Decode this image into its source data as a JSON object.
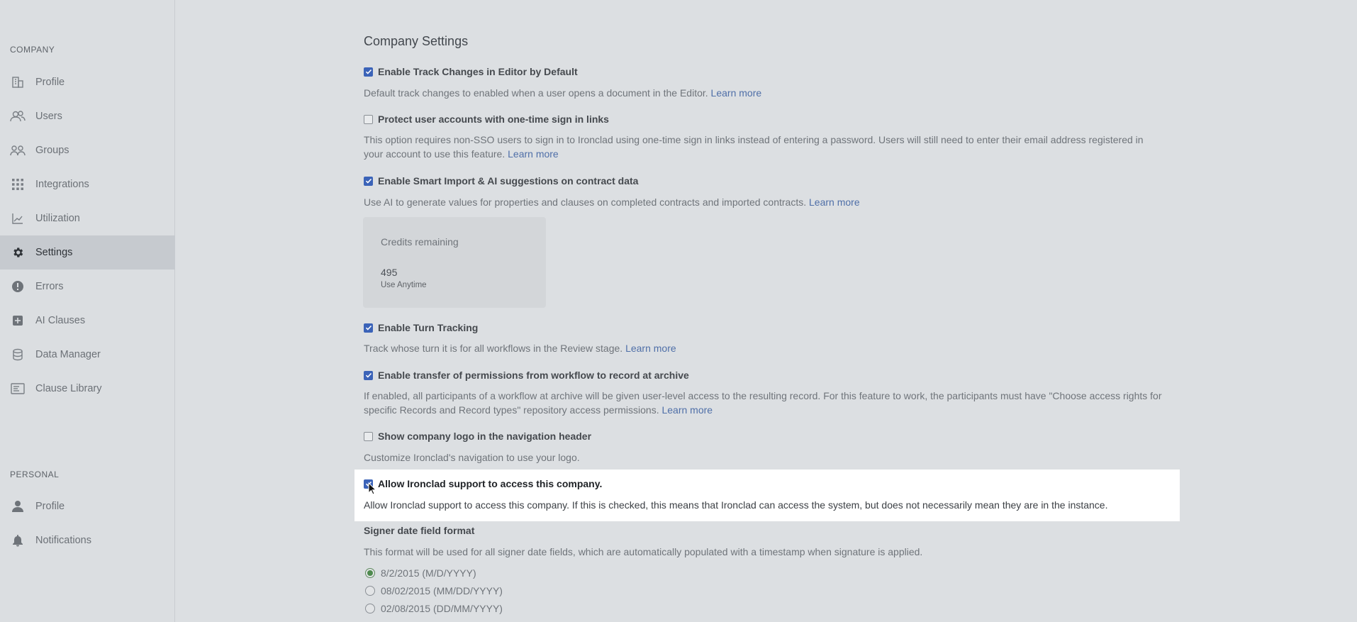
{
  "sidebar": {
    "company_label": "COMPANY",
    "company_items": [
      {
        "label": "Profile",
        "icon": "building-icon"
      },
      {
        "label": "Users",
        "icon": "users-icon"
      },
      {
        "label": "Groups",
        "icon": "groups-icon"
      },
      {
        "label": "Integrations",
        "icon": "grid-icon"
      },
      {
        "label": "Utilization",
        "icon": "chart-icon"
      },
      {
        "label": "Settings",
        "icon": "gear-icon"
      },
      {
        "label": "Errors",
        "icon": "alert-icon"
      },
      {
        "label": "AI Clauses",
        "icon": "ai-plus-icon"
      },
      {
        "label": "Data Manager",
        "icon": "database-icon"
      },
      {
        "label": "Clause Library",
        "icon": "library-icon"
      }
    ],
    "active": "Settings",
    "personal_label": "PERSONAL",
    "personal_items": [
      {
        "label": "Profile",
        "icon": "person-icon"
      },
      {
        "label": "Notifications",
        "icon": "bell-icon"
      }
    ]
  },
  "main": {
    "title": "Company Settings",
    "options": [
      {
        "label": "Enable Track Changes in Editor by Default",
        "checked": true,
        "desc": "Default track changes to enabled when a user opens a document in the Editor.",
        "link": "Learn more"
      },
      {
        "label": "Protect user accounts with one-time sign in links",
        "checked": false,
        "desc": "This option requires non-SSO users to sign in to Ironclad using one-time sign in links instead of entering a password. Users will still need to enter their email address registered in your account to use this feature.",
        "link": "Learn more"
      },
      {
        "label": "Enable Smart Import & AI suggestions on contract data",
        "checked": true,
        "desc": "Use AI to generate values for properties and clauses on completed contracts and imported contracts.",
        "link": "Learn more"
      },
      {
        "label": "Enable Turn Tracking",
        "checked": true,
        "desc": "Track whose turn it is for all workflows in the Review stage.",
        "link": "Learn more"
      },
      {
        "label": "Enable transfer of permissions from workflow to record at archive",
        "checked": true,
        "desc": "If enabled, all participants of a workflow at archive will be given user-level access to the resulting record. For this feature to work, the participants must have \"Choose access rights for specific Records and Record types\" repository access permissions.",
        "link": "Learn more"
      },
      {
        "label": "Show company logo in the navigation header",
        "checked": false,
        "desc": "Customize Ironclad's navigation to use your logo."
      },
      {
        "label": "Allow Ironclad support to access this company.",
        "checked": true,
        "desc": "Allow Ironclad support to access this company. If this is checked, this means that Ironclad can access the system, but does not necessarily mean they are in the instance."
      }
    ],
    "credits": {
      "title": "Credits remaining",
      "value": "495",
      "sub": "Use Anytime"
    },
    "signer_date": {
      "title": "Signer date field format",
      "desc": "This format will be used for all signer date fields, which are automatically populated with a timestamp when signature is applied.",
      "formats": [
        "8/2/2015 (M/D/YYYY)",
        "08/02/2015 (MM/DD/YYYY)",
        "02/08/2015 (DD/MM/YYYY)"
      ],
      "selected": "8/2/2015 (M/D/YYYY)"
    }
  },
  "colors": {
    "accent": "#3b63b8",
    "link": "#4f6fa8",
    "highlight_bg": "#ffffff"
  }
}
